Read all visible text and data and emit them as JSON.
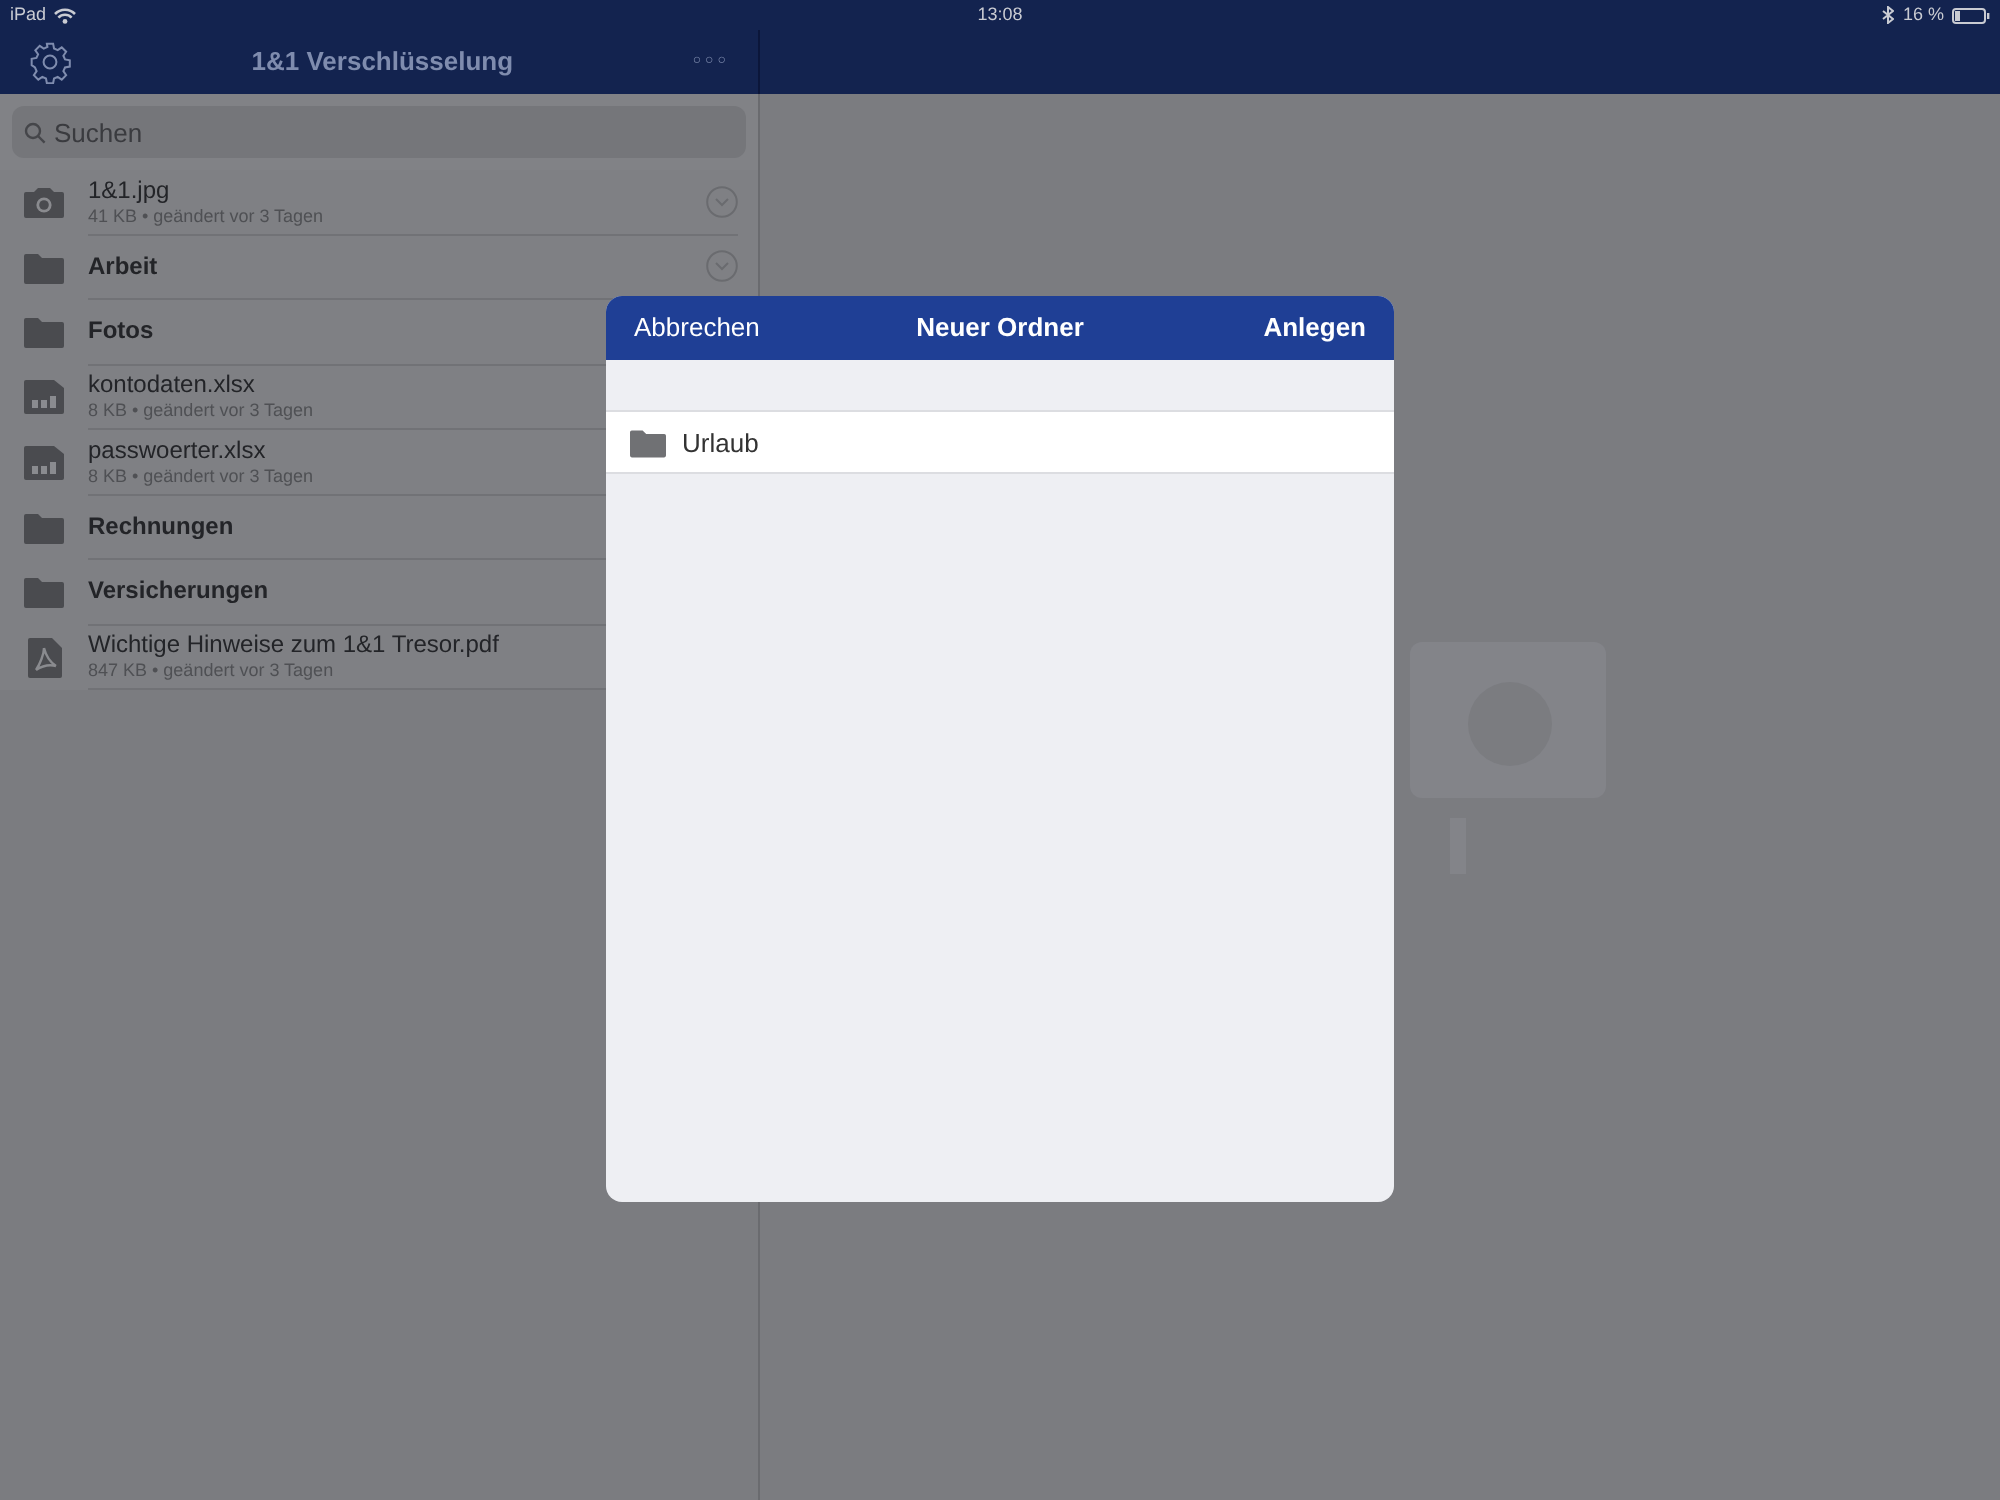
{
  "status_bar": {
    "device": "iPad",
    "time": "13:08",
    "battery": "16 %"
  },
  "nav_bar": {
    "title": "1&1 Verschlüsselung",
    "more": "○○○"
  },
  "search": {
    "placeholder": "Suchen"
  },
  "files": [
    {
      "kind": "image",
      "name": "1&1.jpg",
      "meta": "41 KB • geändert vor 3 Tagen",
      "chevron": true
    },
    {
      "kind": "folder",
      "name": "Arbeit",
      "chevron": true
    },
    {
      "kind": "folder",
      "name": "Fotos",
      "chevron": false
    },
    {
      "kind": "spreadsheet",
      "name": "kontodaten.xlsx",
      "meta": "8 KB • geändert vor 3 Tagen",
      "chevron": false
    },
    {
      "kind": "spreadsheet",
      "name": "passwoerter.xlsx",
      "meta": "8 KB • geändert vor 3 Tagen",
      "chevron": false
    },
    {
      "kind": "folder",
      "name": "Rechnungen",
      "chevron": false
    },
    {
      "kind": "folder",
      "name": "Versicherungen",
      "chevron": false
    },
    {
      "kind": "pdf",
      "name": "Wichtige Hinweise zum 1&1 Tresor.pdf",
      "meta": "847 KB • geändert vor 3 Tagen",
      "chevron": false
    }
  ],
  "dialog": {
    "cancel": "Abbrechen",
    "title": "Neuer Ordner",
    "confirm": "Anlegen",
    "folder_name": "Urlaub"
  }
}
